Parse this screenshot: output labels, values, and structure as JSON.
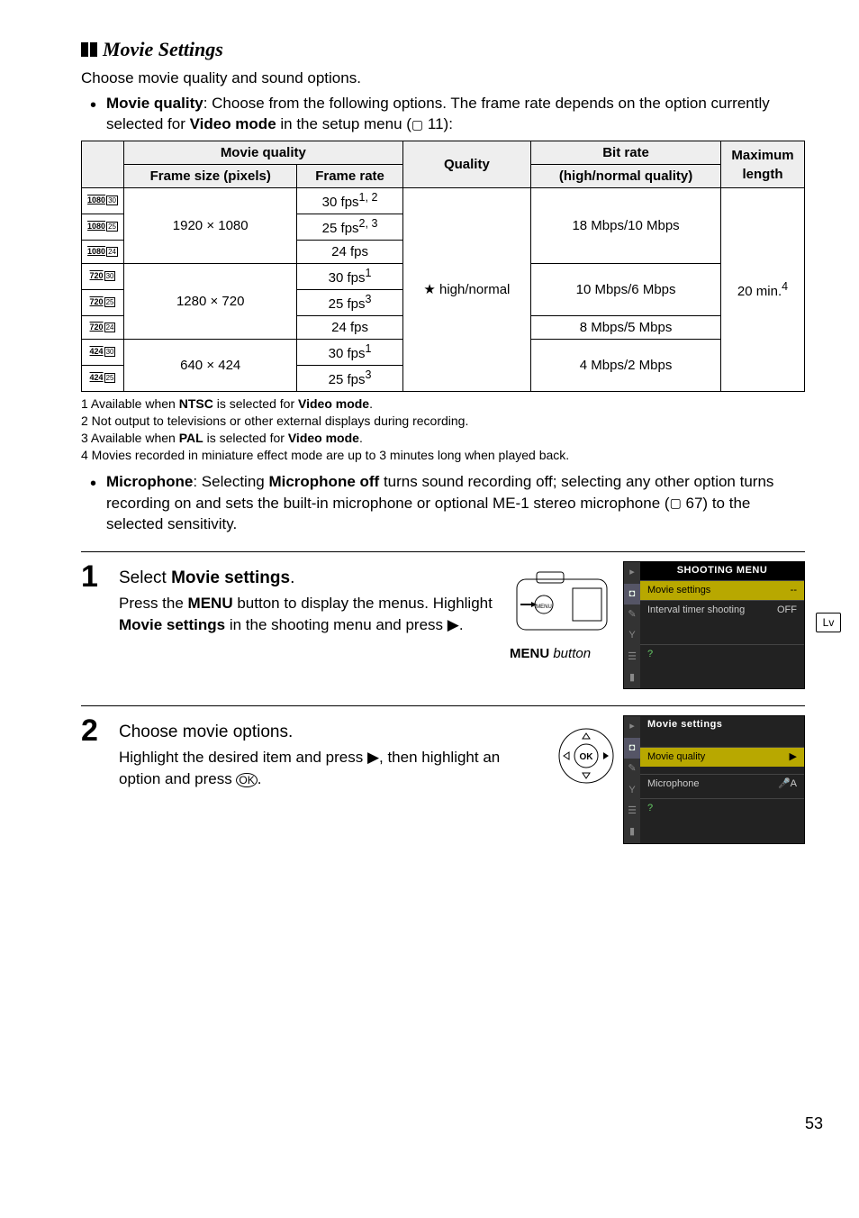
{
  "section_title": "Movie Settings",
  "intro": "Choose movie quality and sound options.",
  "bullet1_label": "Movie quality",
  "bullet1_text": ": Choose from the following options.  The frame rate depends on the option currently selected for ",
  "bullet1_bold2": "Video mode",
  "bullet1_tail": " in the setup menu (",
  "bullet1_ref": " 11):",
  "table": {
    "head_mq": "Movie quality",
    "head_fs": "Frame size (pixels)",
    "head_fr": "Frame rate",
    "head_q": "Quality",
    "head_br": "Bit rate",
    "head_br2": "(high/normal quality)",
    "head_ml": "Maximum length",
    "fs_1080": "1920 × 1080",
    "fs_720": "1280 ×   720",
    "fs_424": "640 ×   424",
    "fr_30_12": "30 fps",
    "fr_30_12_sup": "1, 2",
    "fr_25_23": "25 fps",
    "fr_25_23_sup": "2, 3",
    "fr_24": "24 fps",
    "fr_30_1": "30 fps",
    "fr_30_1_sup": "1",
    "fr_25_3": "25 fps",
    "fr_25_3_sup": "3",
    "quality": "★ high/normal",
    "br_18": "18 Mbps/10 Mbps",
    "br_10": "10 Mbps/6 Mbps",
    "br_8": "8 Mbps/5 Mbps",
    "br_4": "4 Mbps/2 Mbps",
    "maxlen": "20 min.",
    "maxlen_sup": "4"
  },
  "footnotes": {
    "f1": "1  Available when ",
    "f1_b": "NTSC",
    "f1_mid": " is selected for ",
    "f1_b2": "Video mode",
    "f1_end": ".",
    "f2": "2  Not output to televisions or other external displays during recording.",
    "f3": "3  Available when ",
    "f3_b": "PAL",
    "f3_mid": " is selected for ",
    "f3_b2": "Video mode",
    "f3_end": ".",
    "f4": "4  Movies recorded in miniature effect mode are up to 3 minutes long when played back."
  },
  "bullet2_label": "Microphone",
  "bullet2_text1": ": Selecting ",
  "bullet2_bold1": "Microphone off",
  "bullet2_text2": " turns sound recording off; selecting any other option turns recording on and sets the built-in microphone or optional ME-1 stereo microphone (",
  "bullet2_ref": " 67) to the selected sensitivity.",
  "step1": {
    "num": "1",
    "title_pre": "Select ",
    "title_bold": "Movie settings",
    "title_post": ".",
    "text1": "Press the ",
    "text_menu": "MENU",
    "text2": " button to display the menus. Highlight ",
    "text_bold": "Movie settings",
    "text3": " in the shooting menu and press ",
    "text_arrow": "▶",
    "text4": ".",
    "caption_menu": "MENU",
    "caption_rest": " button"
  },
  "lcd1": {
    "header": "SHOOTING MENU",
    "row1_l": "Movie settings",
    "row1_r": "--",
    "row2_l": "Interval timer shooting",
    "row2_r": "OFF"
  },
  "step2": {
    "num": "2",
    "title": "Choose movie options.",
    "text1": "Highlight the desired item and press ",
    "text_arrow": "▶",
    "text2": ", then highlight an option and press ",
    "text_ok": "OK",
    "text3": "."
  },
  "lcd2": {
    "header": "Movie settings",
    "row1_l": "Movie quality",
    "row1_r": "▶",
    "row2_l": "Microphone",
    "row2_r": "A"
  },
  "side_tab": "Lv",
  "page_number": "53",
  "chart_data": {
    "type": "table",
    "title": "Movie quality options",
    "columns": [
      "Frame size (pixels)",
      "Frame rate",
      "Quality",
      "Bit rate (high/normal quality)",
      "Maximum length"
    ],
    "rows": [
      {
        "frame_size": "1920 × 1080",
        "frame_rate": "30 fps",
        "frame_rate_note": "1,2",
        "quality": "high/normal",
        "bit_rate": "18 Mbps/10 Mbps",
        "max_length": "20 min.",
        "max_length_note": "4"
      },
      {
        "frame_size": "1920 × 1080",
        "frame_rate": "25 fps",
        "frame_rate_note": "2,3",
        "quality": "high/normal",
        "bit_rate": "18 Mbps/10 Mbps",
        "max_length": "20 min.",
        "max_length_note": "4"
      },
      {
        "frame_size": "1920 × 1080",
        "frame_rate": "24 fps",
        "frame_rate_note": "",
        "quality": "high/normal",
        "bit_rate": "18 Mbps/10 Mbps",
        "max_length": "20 min.",
        "max_length_note": "4"
      },
      {
        "frame_size": "1280 × 720",
        "frame_rate": "30 fps",
        "frame_rate_note": "1",
        "quality": "high/normal",
        "bit_rate": "10 Mbps/6 Mbps",
        "max_length": "20 min.",
        "max_length_note": "4"
      },
      {
        "frame_size": "1280 × 720",
        "frame_rate": "25 fps",
        "frame_rate_note": "3",
        "quality": "high/normal",
        "bit_rate": "10 Mbps/6 Mbps",
        "max_length": "20 min.",
        "max_length_note": "4"
      },
      {
        "frame_size": "1280 × 720",
        "frame_rate": "24 fps",
        "frame_rate_note": "",
        "quality": "high/normal",
        "bit_rate": "8 Mbps/5 Mbps",
        "max_length": "20 min.",
        "max_length_note": "4"
      },
      {
        "frame_size": "640 × 424",
        "frame_rate": "30 fps",
        "frame_rate_note": "1",
        "quality": "high/normal",
        "bit_rate": "4 Mbps/2 Mbps",
        "max_length": "20 min.",
        "max_length_note": "4"
      },
      {
        "frame_size": "640 × 424",
        "frame_rate": "25 fps",
        "frame_rate_note": "3",
        "quality": "high/normal",
        "bit_rate": "4 Mbps/2 Mbps",
        "max_length": "20 min.",
        "max_length_note": "4"
      }
    ]
  }
}
